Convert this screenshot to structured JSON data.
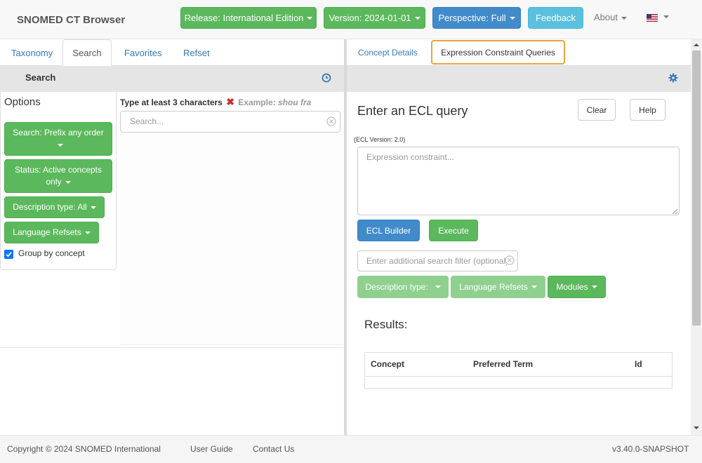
{
  "header": {
    "brand": "SNOMED CT Browser",
    "release_btn": "Release: International Edition",
    "version_btn": "Version: 2024-01-01",
    "perspective_btn": "Perspective: Full",
    "feedback_btn": "Feedback",
    "about": "About",
    "colors": {
      "green": "#5cb85c",
      "blue": "#428bca",
      "light_blue": "#5bc0de"
    }
  },
  "left": {
    "tabs": [
      "Taxonomy",
      "Search",
      "Favorites",
      "Refset"
    ],
    "active_tab": "Search",
    "subheader": "Search",
    "options": {
      "title": "Options",
      "search_mode": "Search: Prefix any order",
      "status": "Status: Active concepts only",
      "description_type": "Description type: All",
      "language_refsets": "Language Refsets",
      "group_by_concept": "Group by concept",
      "group_by_concept_checked": true
    },
    "hint_bold": "Type at least 3 characters",
    "hint_example_label": "Example:",
    "hint_example": "shou fra",
    "search_placeholder": "Search..."
  },
  "right": {
    "tabs": [
      "Concept Details",
      "Expression Constraint Queries"
    ],
    "active_tab": "Expression Constraint Queries",
    "ecl_title": "Enter an ECL query",
    "clear_btn": "Clear",
    "help_btn": "Help",
    "ecl_version": "(ECL Version: 2.0)",
    "ecl_placeholder": "Expression constraint...",
    "ecl_builder_btn": "ECL Builder",
    "execute_btn": "Execute",
    "filter_placeholder": "Enter additional search filter (optional)",
    "description_type_btn": "Description type:",
    "language_refsets_btn": "Language Refsets",
    "modules_btn": "Modules",
    "results_title": "Results:",
    "table_headers": [
      "Concept",
      "Preferred Term",
      "Id"
    ]
  },
  "footer": {
    "copyright": "Copyright © 2024 SNOMED International",
    "user_guide": "User Guide",
    "contact": "Contact Us",
    "version": "v3.40.0-SNAPSHOT"
  }
}
